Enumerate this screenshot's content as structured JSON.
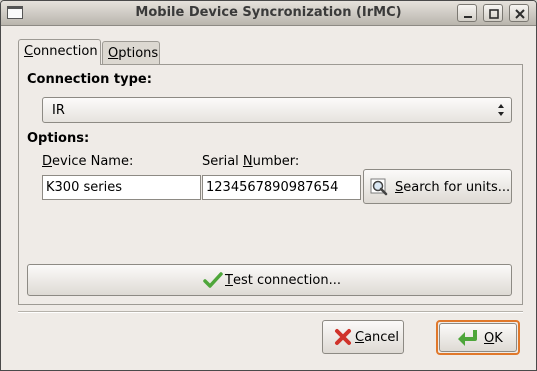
{
  "window": {
    "title": "Mobile Device Syncronization (IrMC)"
  },
  "tabs": [
    {
      "label": "Connection",
      "mnemonic": "C",
      "rest": "onnection",
      "active": true
    },
    {
      "label": "Options",
      "mnemonic": "O",
      "rest": "ptions",
      "active": false
    }
  ],
  "connection": {
    "type_label": "Connection type:",
    "type_value": "IR",
    "options_label": "Options:",
    "device_name_label": {
      "mnemonic": "D",
      "rest": "evice Name:"
    },
    "device_name_value": "K300 series",
    "serial_label": {
      "before": "Serial ",
      "mnemonic": "N",
      "rest": "umber:"
    },
    "serial_value": "1234567890987654",
    "search_button": {
      "mnemonic": "S",
      "rest": "earch for units..."
    },
    "test_button": {
      "mnemonic": "T",
      "rest": "est connection..."
    }
  },
  "footer": {
    "cancel": {
      "mnemonic": "C",
      "rest": "ancel"
    },
    "ok": {
      "mnemonic": "O",
      "rest": "K"
    }
  },
  "colors": {
    "focus": "#e0782b",
    "check": "#4ea63a",
    "cancel_x": "#d0332b"
  }
}
